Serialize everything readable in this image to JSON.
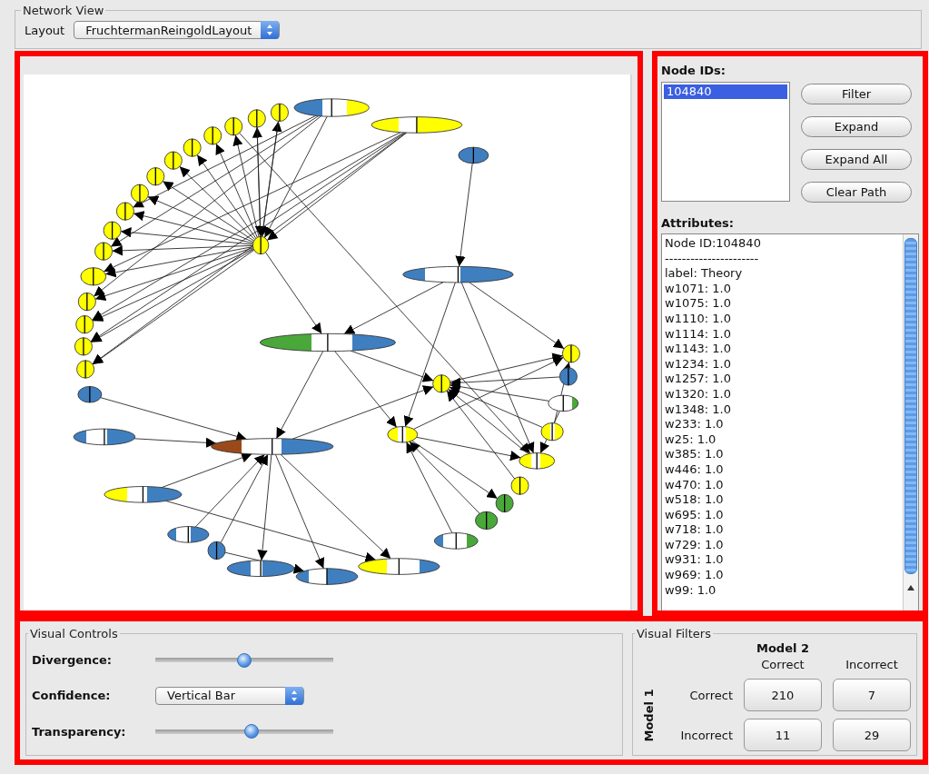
{
  "network_view": {
    "title": "Network View",
    "layout_label": "Layout",
    "layout_value": "FruchtermanReingoldLayout"
  },
  "node_ids": {
    "label": "Node IDs:",
    "items": [
      {
        "text": "104840",
        "selected": true
      }
    ]
  },
  "buttons": [
    "Filter",
    "Expand",
    "Expand All",
    "Clear Path"
  ],
  "attributes": {
    "label": "Attributes:",
    "lines": [
      "Node ID:104840",
      "----------------------",
      "label: Theory",
      "w1071: 1.0",
      "w1075: 1.0",
      "w1110: 1.0",
      "w1114: 1.0",
      "w1143: 1.0",
      "w1234: 1.0",
      "w1257: 1.0",
      "w1320: 1.0",
      "w1348: 1.0",
      "w233: 1.0",
      "w25: 1.0",
      "w385: 1.0",
      "w446: 1.0",
      "w470: 1.0",
      "w518: 1.0",
      "w695: 1.0",
      "w718: 1.0",
      "w729: 1.0",
      "w931: 1.0",
      "w969: 1.0",
      "w99: 1.0"
    ]
  },
  "visual_controls": {
    "title": "Visual Controls",
    "rows": [
      {
        "kind": "slider",
        "label": "Divergence:",
        "level": 0.5
      },
      {
        "kind": "dropdown",
        "label": "Confidence:",
        "value": "Vertical Bar"
      },
      {
        "kind": "slider",
        "label": "Transparency:",
        "level": 0.54
      }
    ]
  },
  "visual_filters": {
    "title": "Visual Filters",
    "column_group": "Model 2",
    "row_group": "Model 1",
    "columns": [
      "Correct",
      "Incorrect"
    ],
    "rows": [
      {
        "label": "Correct",
        "cells": [
          "210",
          "7"
        ]
      },
      {
        "label": "Incorrect",
        "cells": [
          "11",
          "29"
        ]
      }
    ]
  }
}
